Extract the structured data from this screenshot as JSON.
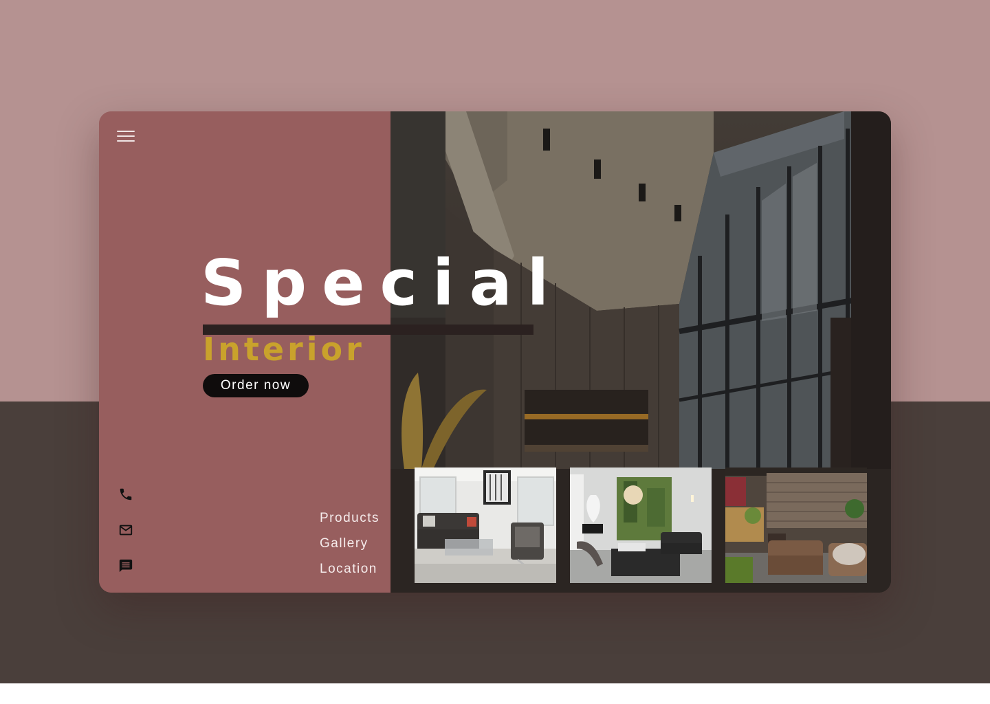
{
  "hero": {
    "title": "Special",
    "subtitle": "Interior",
    "cta_label": "Order now"
  },
  "nav": {
    "items": [
      {
        "label": "Products"
      },
      {
        "label": "Gallery"
      },
      {
        "label": "Location"
      }
    ]
  },
  "icons": {
    "menu": "menu-icon",
    "contacts": [
      "phone-icon",
      "mail-icon",
      "chat-icon"
    ]
  },
  "gallery": {
    "thumbnails": [
      "living-room-photo",
      "modern-lounge-photo",
      "cafe-lounge-photo"
    ]
  },
  "colors": {
    "page_top": "#b59291",
    "page_bottom": "#4a3f3b",
    "panel": "#975e5e",
    "accent_gold": "#c9a22c",
    "button": "#0f0c0c"
  }
}
